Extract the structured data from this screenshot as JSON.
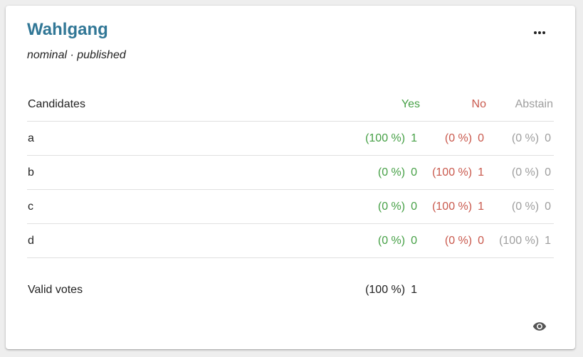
{
  "poll": {
    "title": "Wahlgang",
    "subtitle": "nominal · published"
  },
  "table": {
    "headers": {
      "candidates": "Candidates",
      "yes": "Yes",
      "no": "No",
      "abstain": "Abstain"
    },
    "rows": [
      {
        "name": "a",
        "yes_pct": "(100 %)",
        "yes": "1",
        "no_pct": "(0 %)",
        "no": "0",
        "abstain_pct": "(0 %)",
        "abstain": "0"
      },
      {
        "name": "b",
        "yes_pct": "(0 %)",
        "yes": "0",
        "no_pct": "(100 %)",
        "no": "1",
        "abstain_pct": "(0 %)",
        "abstain": "0"
      },
      {
        "name": "c",
        "yes_pct": "(0 %)",
        "yes": "0",
        "no_pct": "(100 %)",
        "no": "1",
        "abstain_pct": "(0 %)",
        "abstain": "0"
      },
      {
        "name": "d",
        "yes_pct": "(0 %)",
        "yes": "0",
        "no_pct": "(0 %)",
        "no": "0",
        "abstain_pct": "(100 %)",
        "abstain": "1"
      }
    ],
    "valid_votes": {
      "label": "Valid votes",
      "pct": "(100 %)",
      "value": "1"
    }
  },
  "icons": {
    "menu": "more-horiz-icon",
    "visibility": "eye-icon"
  },
  "colors": {
    "title": "#317796",
    "yes": "#46a046",
    "no": "#c9594d",
    "abstain": "#9e9e9e"
  }
}
